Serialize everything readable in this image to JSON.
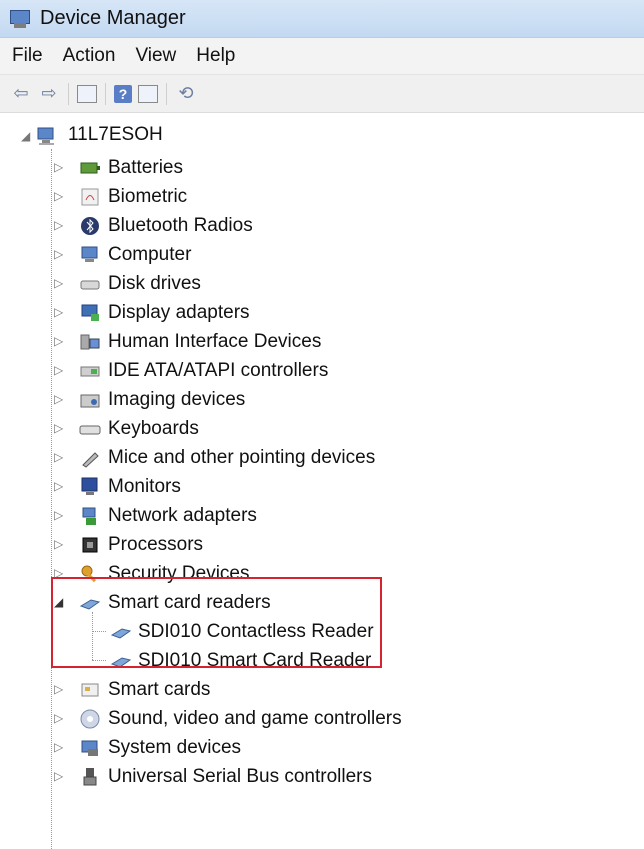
{
  "window": {
    "title": "Device Manager"
  },
  "menu": [
    "File",
    "Action",
    "View",
    "Help"
  ],
  "toolbar": [
    {
      "icon": "back-arrow-icon"
    },
    {
      "icon": "forward-arrow-icon"
    },
    {
      "icon": "properties-icon"
    },
    {
      "icon": "help-icon",
      "glyph": "?"
    },
    {
      "icon": "update-driver-icon"
    },
    {
      "icon": "scan-hardware-icon"
    }
  ],
  "tree": {
    "root": "11L7ESOH",
    "categories": [
      {
        "label": "Batteries",
        "icon": "battery-icon"
      },
      {
        "label": "Biometric",
        "icon": "biometric-icon"
      },
      {
        "label": "Bluetooth Radios",
        "icon": "bluetooth-icon"
      },
      {
        "label": "Computer",
        "icon": "computer-icon"
      },
      {
        "label": "Disk drives",
        "icon": "disk-drive-icon"
      },
      {
        "label": "Display adapters",
        "icon": "display-adapter-icon"
      },
      {
        "label": "Human Interface Devices",
        "icon": "hid-icon"
      },
      {
        "label": "IDE ATA/ATAPI controllers",
        "icon": "ide-controller-icon"
      },
      {
        "label": "Imaging devices",
        "icon": "imaging-device-icon"
      },
      {
        "label": "Keyboards",
        "icon": "keyboard-icon"
      },
      {
        "label": "Mice and other pointing devices",
        "icon": "mouse-icon"
      },
      {
        "label": "Monitors",
        "icon": "monitor-icon"
      },
      {
        "label": "Network adapters",
        "icon": "network-adapter-icon"
      },
      {
        "label": "Processors",
        "icon": "processor-icon"
      },
      {
        "label": "Security Devices",
        "icon": "security-key-icon"
      },
      {
        "label": "Smart card readers",
        "icon": "smart-card-reader-icon",
        "expanded": true,
        "children": [
          "SDI010 Contactless Reader",
          "SDI010 Smart Card Reader"
        ]
      },
      {
        "label": "Smart cards",
        "icon": "smart-card-icon"
      },
      {
        "label": "Sound, video and game controllers",
        "icon": "sound-icon"
      },
      {
        "label": "System devices",
        "icon": "system-device-icon"
      },
      {
        "label": "Universal Serial Bus controllers",
        "icon": "usb-icon"
      }
    ]
  }
}
